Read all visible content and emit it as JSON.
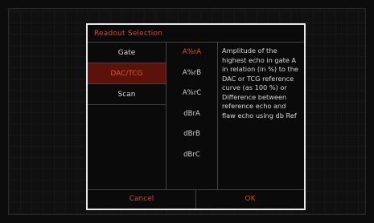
{
  "dialog": {
    "title": "Readout Selection",
    "left_items": [
      "Gate",
      "DAC/TCG",
      "Scan"
    ],
    "left_active_index": 1,
    "mid_items": [
      "A%rA",
      "A%rB",
      "A%rC",
      "dBrA",
      "dBrB",
      "dBrC"
    ],
    "mid_active_index": 0,
    "description": "Amplitude of the highest echo in gate A in relation (in %) to the DAC or TCG reference curve (as 100 %) or Difference between reference echo and flaw echo using db Ref",
    "cancel_label": "Cancel",
    "ok_label": "OK"
  },
  "colors": {
    "accent": "#d9491f",
    "active_bg": "#5a120a",
    "border": "#e8e8e8"
  }
}
